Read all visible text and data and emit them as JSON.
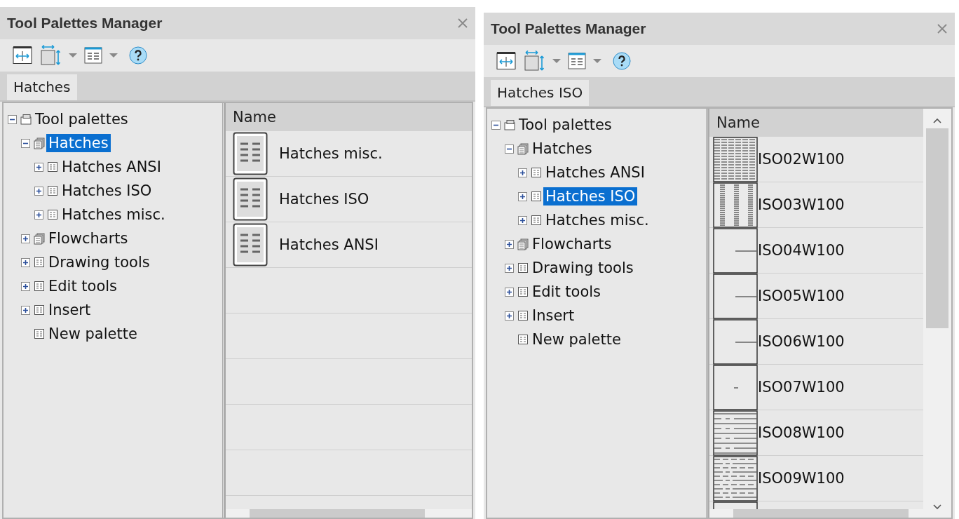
{
  "panels": [
    {
      "title": "Tool Palettes Manager",
      "tabs": [
        {
          "label": "Hatches",
          "selected": true
        }
      ],
      "tree": [
        {
          "label": "Tool palettes",
          "kind": "root",
          "expanded": true,
          "selected": false,
          "children": [
            {
              "label": "Hatches",
              "kind": "group",
              "expanded": true,
              "selected": true,
              "children": [
                {
                  "label": "Hatches ANSI",
                  "kind": "palette",
                  "expanded": false,
                  "selected": false
                },
                {
                  "label": "Hatches ISO",
                  "kind": "palette",
                  "expanded": false,
                  "selected": false
                },
                {
                  "label": "Hatches misc.",
                  "kind": "palette",
                  "expanded": false,
                  "selected": false
                }
              ]
            },
            {
              "label": "Flowcharts",
              "kind": "group",
              "expanded": false,
              "selected": false
            },
            {
              "label": "Drawing tools",
              "kind": "palette",
              "expanded": false,
              "selected": false
            },
            {
              "label": "Edit tools",
              "kind": "palette",
              "expanded": false,
              "selected": false
            },
            {
              "label": "Insert",
              "kind": "palette",
              "expanded": false,
              "selected": false
            },
            {
              "label": "New palette",
              "kind": "palette"
            }
          ]
        }
      ],
      "list": {
        "column": "Name",
        "scroll": false,
        "rows": [
          {
            "label": "Hatches misc.",
            "kind": "palette"
          },
          {
            "label": "Hatches ISO",
            "kind": "palette"
          },
          {
            "label": "Hatches ANSI",
            "kind": "palette"
          }
        ]
      }
    },
    {
      "title": "Tool Palettes Manager",
      "tabs": [
        {
          "label": "Hatches ISO",
          "selected": true
        }
      ],
      "tree": [
        {
          "label": "Tool palettes",
          "kind": "root",
          "expanded": true,
          "selected": false,
          "children": [
            {
              "label": "Hatches",
              "kind": "group",
              "expanded": true,
              "selected": false,
              "children": [
                {
                  "label": "Hatches ANSI",
                  "kind": "palette",
                  "expanded": false,
                  "selected": false
                },
                {
                  "label": "Hatches ISO",
                  "kind": "palette",
                  "expanded": false,
                  "selected": true
                },
                {
                  "label": "Hatches misc.",
                  "kind": "palette",
                  "expanded": false,
                  "selected": false
                }
              ]
            },
            {
              "label": "Flowcharts",
              "kind": "group",
              "expanded": false,
              "selected": false
            },
            {
              "label": "Drawing tools",
              "kind": "palette",
              "expanded": false,
              "selected": false
            },
            {
              "label": "Edit tools",
              "kind": "palette",
              "expanded": false,
              "selected": false
            },
            {
              "label": "Insert",
              "kind": "palette",
              "expanded": false,
              "selected": false
            },
            {
              "label": "New palette",
              "kind": "palette"
            }
          ]
        }
      ],
      "list": {
        "column": "Name",
        "scroll": true,
        "rows": [
          {
            "label": "ISO02W100",
            "kind": "dense"
          },
          {
            "label": "ISO03W100",
            "kind": "columns"
          },
          {
            "label": "ISO04W100",
            "kind": "line"
          },
          {
            "label": "ISO05W100",
            "kind": "line"
          },
          {
            "label": "ISO06W100",
            "kind": "line"
          },
          {
            "label": "ISO07W100",
            "kind": "dash"
          },
          {
            "label": "ISO08W100",
            "kind": "dashlines"
          },
          {
            "label": "ISO09W100",
            "kind": "dashlines2"
          },
          {
            "kind": "blank"
          }
        ]
      }
    }
  ]
}
